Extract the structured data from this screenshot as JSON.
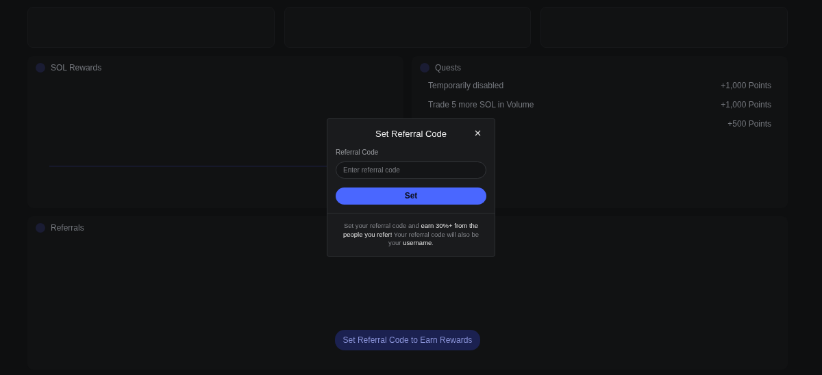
{
  "background": {
    "rewards_panel": {
      "title": "SOL Rewards"
    },
    "quests_panel": {
      "title": "Quests",
      "quests": [
        {
          "label": "Temporarily disabled",
          "points": "+1,000 Points"
        },
        {
          "label": "Trade 5 more SOL in Volume",
          "points": "+1,000 Points"
        },
        {
          "points": "+500 Points"
        }
      ]
    },
    "referrals_panel": {
      "title": "Referrals",
      "action": "Set Referral Code to Earn Rewards"
    }
  },
  "dialog": {
    "title": "Set Referral Code",
    "field": {
      "label": "Referral Code",
      "placeholder": "Enter referral code"
    },
    "submit": "Set",
    "note": "Set your referral code and **earn 30%+ from the people you refer!** Your referral code will also be your **username**."
  }
}
